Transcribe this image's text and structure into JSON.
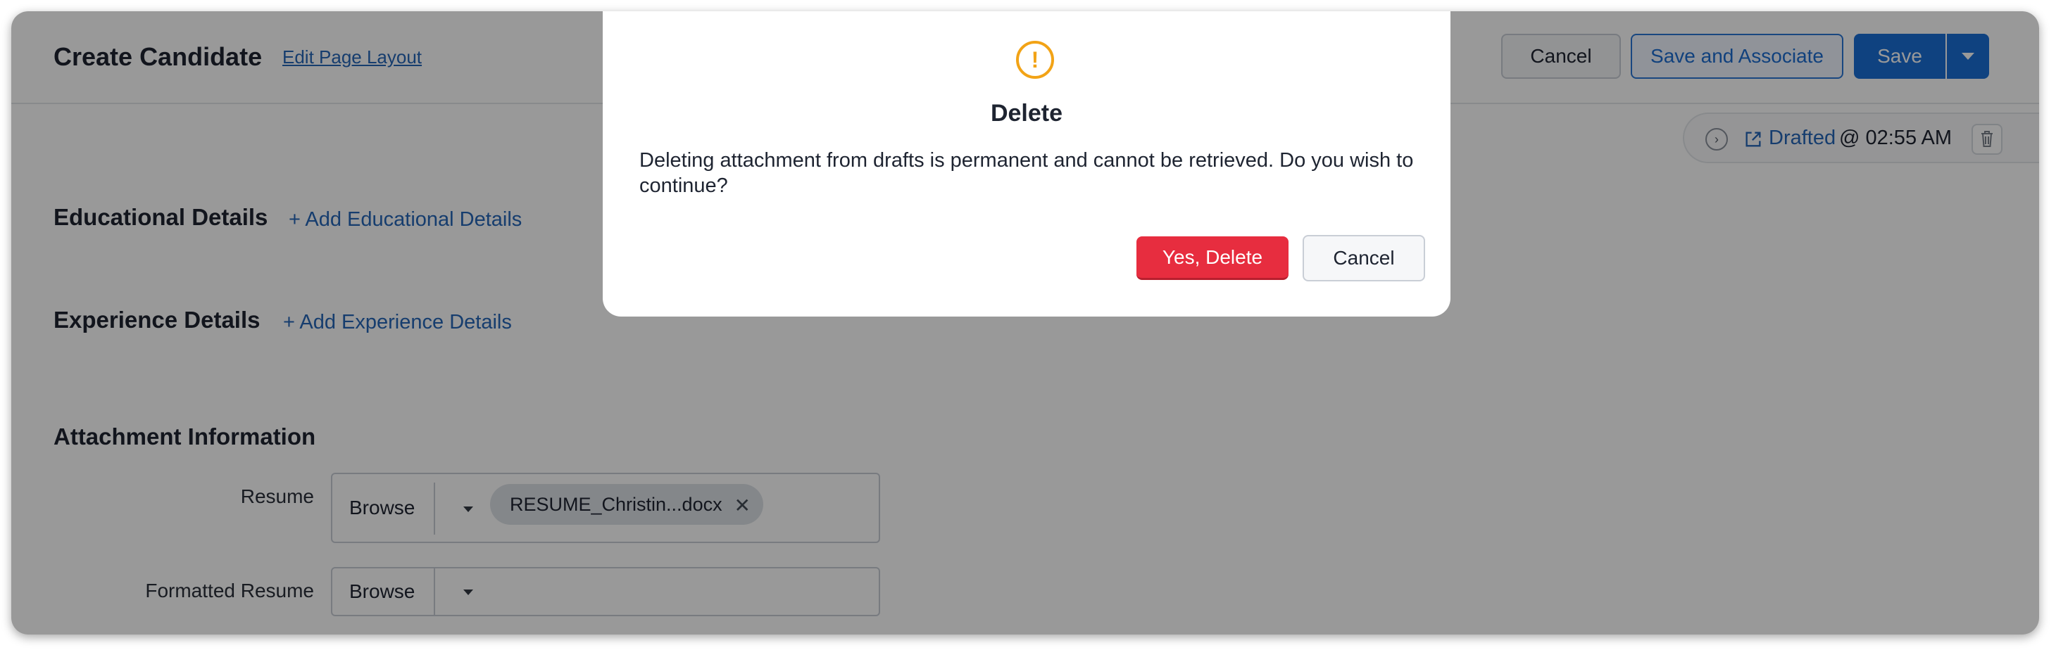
{
  "header": {
    "title": "Create Candidate",
    "edit_layout": "Edit Page Layout",
    "cancel_label": "Cancel",
    "save_associate_label": "Save and Associate",
    "save_label": "Save"
  },
  "draft": {
    "link": "Drafted",
    "time": "@ 02:55 AM"
  },
  "sections": {
    "educational": {
      "title": "Educational Details",
      "add": "+ Add Educational Details"
    },
    "experience": {
      "title": "Experience Details",
      "add": "+ Add Experience Details"
    },
    "attachment": {
      "title": "Attachment Information",
      "resume_label": "Resume",
      "formatted_resume_label": "Formatted Resume",
      "browse_label": "Browse",
      "resume_file": "RESUME_Christin...docx"
    }
  },
  "modal": {
    "title": "Delete",
    "message": "Deleting attachment from drafts is permanent and cannot be retrieved. Do you wish to continue?",
    "confirm_label": "Yes, Delete",
    "cancel_label": "Cancel"
  },
  "colors": {
    "accent": "#1a6fd6",
    "danger": "#e72d3f",
    "warning": "#f2a316",
    "link": "#2566b8"
  },
  "icons": [
    "warning-icon",
    "chevron-right-icon",
    "external-link-icon",
    "trash-icon",
    "close-icon",
    "chevron-down-icon"
  ]
}
